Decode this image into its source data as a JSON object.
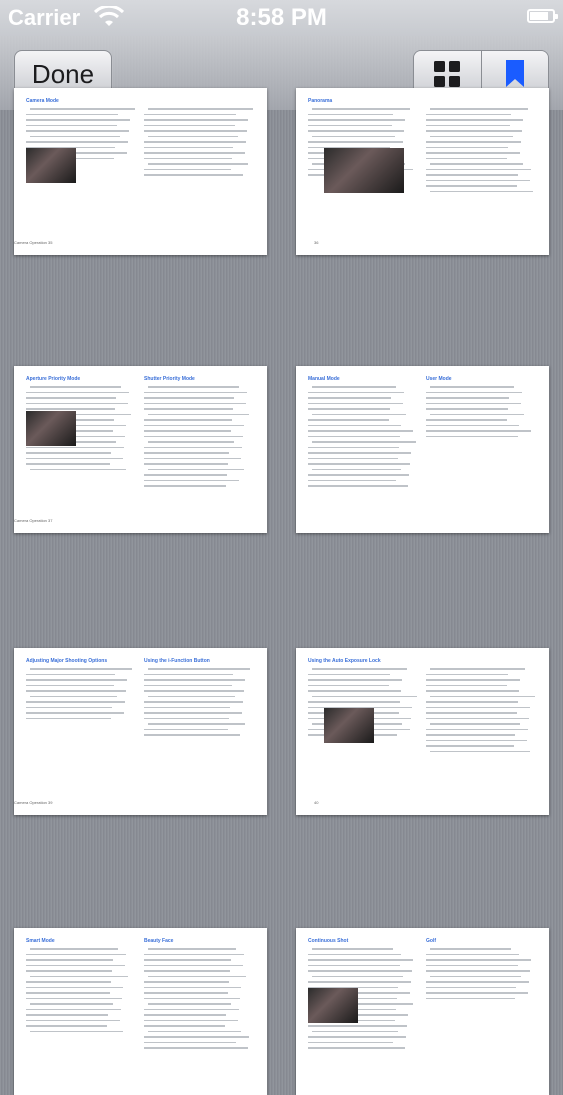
{
  "status_bar": {
    "carrier": "Carrier",
    "time": "8:58 PM",
    "battery_level": 0.8
  },
  "toolbar": {
    "done_label": "Done",
    "icons": [
      "grid-icon",
      "bookmark-icon"
    ],
    "bookmark_color": "#1a5cff"
  },
  "pages": [
    {
      "headings": [
        "Camera Mode",
        ""
      ],
      "footer": "Camera Operation 35"
    },
    {
      "headings": [
        "Panorama",
        ""
      ],
      "footer": "36"
    },
    {
      "headings": [
        "Aperture Priority Mode",
        "Shutter Priority Mode"
      ],
      "footer": "Camera Operation 37"
    },
    {
      "headings": [
        "Manual Mode",
        "User Mode"
      ],
      "footer": ""
    },
    {
      "headings": [
        "Adjusting Major Shooting Options",
        "Using the i-Function Button"
      ],
      "footer": "Camera Operation 39"
    },
    {
      "headings": [
        "Using the Auto Exposure Lock",
        ""
      ],
      "footer": "40"
    },
    {
      "headings": [
        "Smart Mode",
        "Beauty Face"
      ],
      "footer": ""
    },
    {
      "headings": [
        "Continuous Shot",
        "Golf"
      ],
      "footer": ""
    }
  ]
}
